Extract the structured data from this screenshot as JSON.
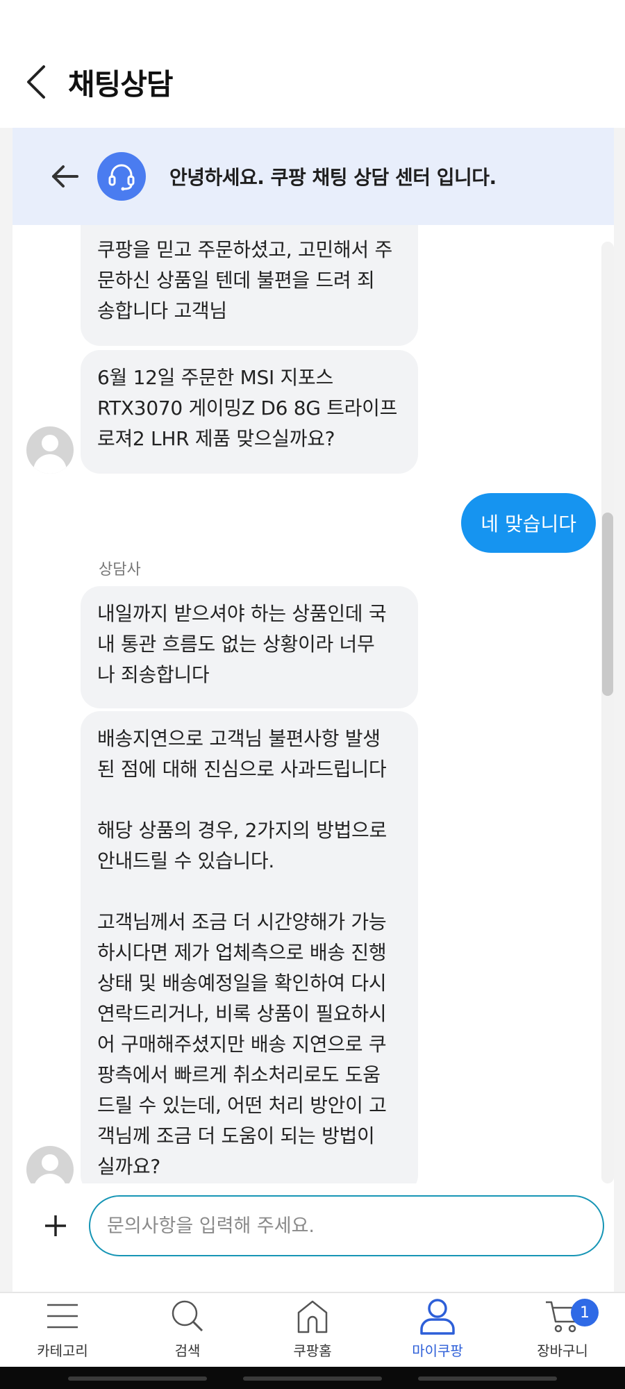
{
  "header": {
    "title": "채팅상담"
  },
  "banner": {
    "text": "안녕하세요. 쿠팡 채팅 상담 센터 입니다."
  },
  "messages": [
    {
      "from": "agent",
      "text": "쿠팡을 믿고 주문하셨고, 고민해서 주\n문하신 상품일 텐데 불편을 드려 죄\n송합니다 고객님"
    },
    {
      "from": "agent",
      "text": "6월 12일 주문한 MSI 지포스\nRTX3070 게이밍Z D6 8G 트라이프\n로져2 LHR 제품 맞으실까요?"
    },
    {
      "from": "user",
      "text": "네 맞습니다"
    },
    {
      "from": "agent",
      "sender": "상담사",
      "text": "내일까지 받으셔야 하는 상품인데 국\n내 통관 흐름도 없는 상황이라 너무\n나 죄송합니다"
    },
    {
      "from": "agent",
      "text": "배송지연으로 고객님 불편사항 발생\n된 점에 대해 진심으로 사과드립니다\n\n해당 상품의 경우, 2가지의 방법으로\n안내드릴 수 있습니다.\n\n고객님께서 조금 더 시간양해가 가능\n하시다면 제가 업체측으로 배송 진행\n상태 및 배송예정일을 확인하여 다시\n연락드리거나, 비록 상품이 필요하시\n어 구매해주셨지만 배송 지연으로 쿠\n팡측에서 빠르게 취소처리로도 도움\n드릴 수 있는데, 어떤 처리 방안이 고\n객님께 조금 더 도움이 되는 방법이\n실까요?"
    }
  ],
  "composer": {
    "placeholder": "문의사항을 입력해 주세요."
  },
  "tabbar": {
    "items": [
      {
        "label": "카테고리",
        "icon": "menu-icon"
      },
      {
        "label": "검색",
        "icon": "search-icon"
      },
      {
        "label": "쿠팡홈",
        "icon": "home-icon"
      },
      {
        "label": "마이쿠팡",
        "icon": "person-icon",
        "active": true
      },
      {
        "label": "장바구니",
        "icon": "cart-icon",
        "badge": "1"
      }
    ]
  },
  "colors": {
    "accent": "#2d5fd8",
    "user_bubble": "#1694f0",
    "banner_bg": "#e8eefb",
    "agent_avatar": "#4a7cf0"
  }
}
